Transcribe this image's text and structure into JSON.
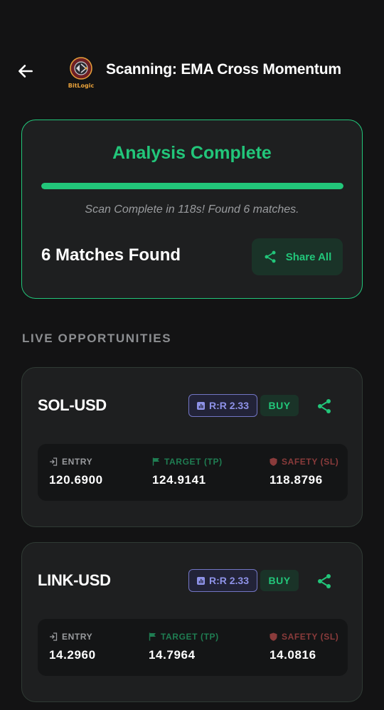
{
  "header": {
    "title": "Scanning: EMA Cross Momentum",
    "logo_text": "BitLogic"
  },
  "summary": {
    "title": "Analysis Complete",
    "progress_percent": 100,
    "status": "Scan Complete in 118s! Found 6 matches.",
    "matches": "6 Matches Found",
    "share_all_label": "Share All"
  },
  "section_label": "LIVE OPPORTUNITIES",
  "opportunities": [
    {
      "symbol": "SOL-USD",
      "rr": "R:R 2.33",
      "signal": "BUY",
      "entry_label": "ENTRY",
      "entry": "120.6900",
      "target_label": "TARGET (TP)",
      "target": "124.9141",
      "safety_label": "SAFETY (SL)",
      "safety": "118.8796"
    },
    {
      "symbol": "LINK-USD",
      "rr": "R:R 2.33",
      "signal": "BUY",
      "entry_label": "ENTRY",
      "entry": "14.2960",
      "target_label": "TARGET (TP)",
      "target": "14.7964",
      "safety_label": "SAFETY (SL)",
      "safety": "14.0816"
    }
  ],
  "colors": {
    "background": "#131314",
    "card": "#1e1f20",
    "accent_green": "#22c67a",
    "rr_purple": "#8e92e8",
    "safety_red": "#8a3b3b"
  },
  "icons": {
    "back": "arrow-left-icon",
    "share": "share-icon",
    "rr": "chart-icon",
    "entry": "login-icon",
    "target": "flag-icon",
    "safety": "shield-icon"
  }
}
